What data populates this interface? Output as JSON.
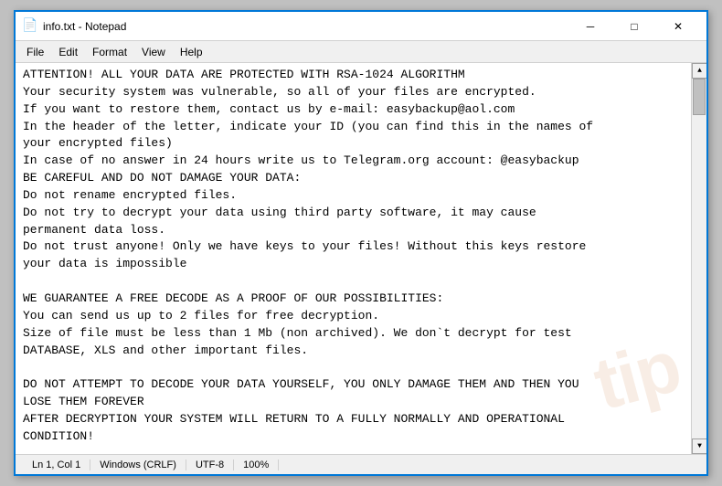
{
  "window": {
    "title": "info.txt - Notepad",
    "icon": "📄"
  },
  "titlebar_controls": {
    "minimize": "─",
    "maximize": "□",
    "close": "✕"
  },
  "menu": {
    "items": [
      "File",
      "Edit",
      "Format",
      "View",
      "Help"
    ]
  },
  "content": {
    "text": "ATTENTION! ALL YOUR DATA ARE PROTECTED WITH RSA-1024 ALGORITHM\nYour security system was vulnerable, so all of your files are encrypted.\nIf you want to restore them, contact us by e-mail: easybackup@aol.com\nIn the header of the letter, indicate your ID (you can find this in the names of\nyour encrypted files)\nIn case of no answer in 24 hours write us to Telegram.org account: @easybackup\nBE CAREFUL AND DO NOT DAMAGE YOUR DATA:\nDo not rename encrypted files.\nDo not try to decrypt your data using third party software, it may cause\npermanent data loss.\nDo not trust anyone! Only we have keys to your files! Without this keys restore\nyour data is impossible\n\nWE GUARANTEE A FREE DECODE AS A PROOF OF OUR POSSIBILITIES:\nYou can send us up to 2 files for free decryption.\nSize of file must be less than 1 Mb (non archived). We don`t decrypt for test\nDATABASE, XLS and other important files.\n\nDO NOT ATTEMPT TO DECODE YOUR DATA YOURSELF, YOU ONLY DAMAGE THEM AND THEN YOU\nLOSE THEM FOREVER\nAFTER DECRYPTION YOUR SYSTEM WILL RETURN TO A FULLY NORMALLY AND OPERATIONAL\nCONDITION!"
  },
  "status": {
    "ln": "Ln 1, Col 1",
    "encoding": "UTF-8",
    "eol": "Windows (CRLF)",
    "zoom": "100%"
  },
  "watermark": {
    "text": "tip"
  }
}
